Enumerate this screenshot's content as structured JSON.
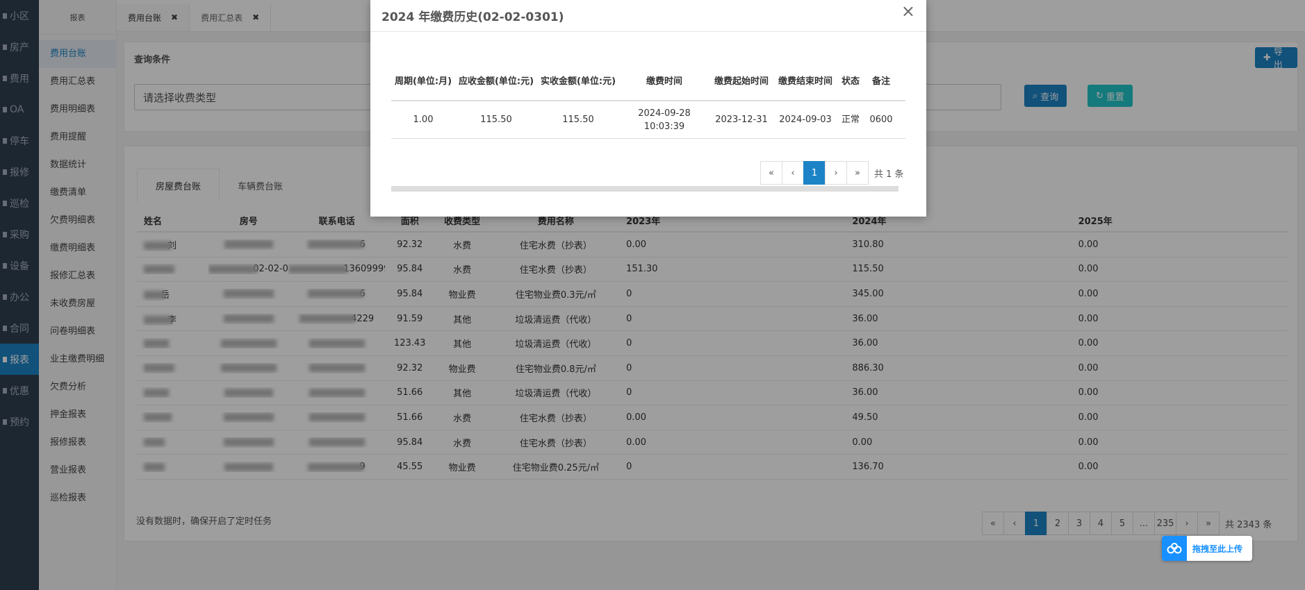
{
  "nav": {
    "items": [
      "小区",
      "房产",
      "费用",
      "OA",
      "停车",
      "报修",
      "巡检",
      "采购",
      "设备",
      "办公",
      "合同",
      "报表",
      "优惠",
      "预约"
    ],
    "active_index": 11
  },
  "subnav": {
    "header": "报表",
    "items": [
      "费用台账",
      "费用汇总表",
      "费用明细表",
      "费用提醒",
      "数据统计",
      "缴费清单",
      "欠费明细表",
      "缴费明细表",
      "报修汇总表",
      "未收费房屋",
      "问卷明细表",
      "业主缴费明细",
      "欠费分析",
      "押金报表",
      "报修报表",
      "营业报表",
      "巡检报表"
    ],
    "active_index": 0
  },
  "tabs": [
    {
      "label": "费用台账",
      "close": "✖"
    },
    {
      "label": "费用汇总表",
      "close": "✖"
    }
  ],
  "query": {
    "title": "查询条件",
    "placeholder": "请选择收费类型",
    "query_label": "查询",
    "reset_label": "重置",
    "export_label": "导出"
  },
  "subtabs": [
    "房屋费台账",
    "车辆费台账"
  ],
  "table": {
    "headers": [
      "姓名",
      "房号",
      "联系电话",
      "面积",
      "收费类型",
      "费用名称",
      "2023年",
      "2024年",
      "2025年"
    ],
    "rows": [
      {
        "name": "刘",
        "room": "",
        "phone": "6",
        "area": "92.32",
        "type": "水费",
        "fee": "住宅水费（抄表）",
        "y2023": "0.00",
        "y2024": "310.80",
        "y2025": "0.00"
      },
      {
        "name": "",
        "room": "02-02-0301",
        "phone": "13609999021",
        "area": "95.84",
        "type": "水费",
        "fee": "住宅水费（抄表）",
        "y2023": "151.30",
        "y2024": "115.50",
        "y2025": "0.00"
      },
      {
        "name": "岳",
        "room": "",
        "phone": "6",
        "area": "95.84",
        "type": "物业费",
        "fee": "住宅物业费0.3元/㎡",
        "y2023": "0",
        "y2024": "345.00",
        "y2025": "0.00"
      },
      {
        "name": "李",
        "room": "",
        "phone": "4229",
        "area": "91.59",
        "type": "其他",
        "fee": "垃圾清运费（代收）",
        "y2023": "0",
        "y2024": "36.00",
        "y2025": "0.00"
      },
      {
        "name": "",
        "room": "",
        "phone": "",
        "area": "123.43",
        "type": "其他",
        "fee": "垃圾清运费（代收）",
        "y2023": "0",
        "y2024": "36.00",
        "y2025": "0.00"
      },
      {
        "name": "",
        "room": "",
        "phone": "",
        "area": "92.32",
        "type": "物业费",
        "fee": "住宅物业费0.8元/㎡",
        "y2023": "0",
        "y2024": "886.30",
        "y2025": "0.00"
      },
      {
        "name": "",
        "room": "",
        "phone": "",
        "area": "51.66",
        "type": "其他",
        "fee": "垃圾清运费（代收）",
        "y2023": "0",
        "y2024": "36.00",
        "y2025": "0.00"
      },
      {
        "name": "",
        "room": "",
        "phone": "",
        "area": "51.66",
        "type": "水费",
        "fee": "住宅水费（抄表）",
        "y2023": "0.00",
        "y2024": "49.50",
        "y2025": "0.00"
      },
      {
        "name": "",
        "room": "",
        "phone": "",
        "area": "95.84",
        "type": "水费",
        "fee": "住宅水费（抄表）",
        "y2023": "0.00",
        "y2024": "0.00",
        "y2025": "0.00"
      },
      {
        "name": "",
        "room": "",
        "phone": "9",
        "area": "45.55",
        "type": "物业费",
        "fee": "住宅物业费0.25元/㎡",
        "y2023": "0",
        "y2024": "136.70",
        "y2025": "0.00"
      }
    ]
  },
  "footnote": "没有数据时，确保开启了定时任务",
  "pager": {
    "items": [
      "«",
      "‹",
      "1",
      "2",
      "3",
      "4",
      "5",
      "...",
      "235",
      "›",
      "»"
    ],
    "active": "1",
    "total": "共 2343 条"
  },
  "upload": {
    "label": "拖拽至此上传"
  },
  "modal": {
    "title": "2024 年缴费历史(02-02-0301)",
    "close": "×",
    "headers": [
      "周期(单位:月)",
      "应收金额(单位:元)",
      "实收金额(单位:元)",
      "缴费时间",
      "缴费起始时间",
      "缴费结束时间",
      "状态",
      "备注"
    ],
    "rows": [
      {
        "cycle": "1.00",
        "receivable": "115.50",
        "received": "115.50",
        "pay_time": "2024-09-28 10:03:39",
        "start": "2023-12-31",
        "end": "2024-09-03",
        "status": "正常",
        "remark": "0600"
      }
    ],
    "pager": {
      "items": [
        "«",
        "‹",
        "1",
        "›",
        "»"
      ],
      "active": "1",
      "total": "共 1 条"
    }
  },
  "colors": {
    "nav_bg": "#2f4050",
    "primary": "#1c84c6",
    "teal": "#23c6c8"
  }
}
